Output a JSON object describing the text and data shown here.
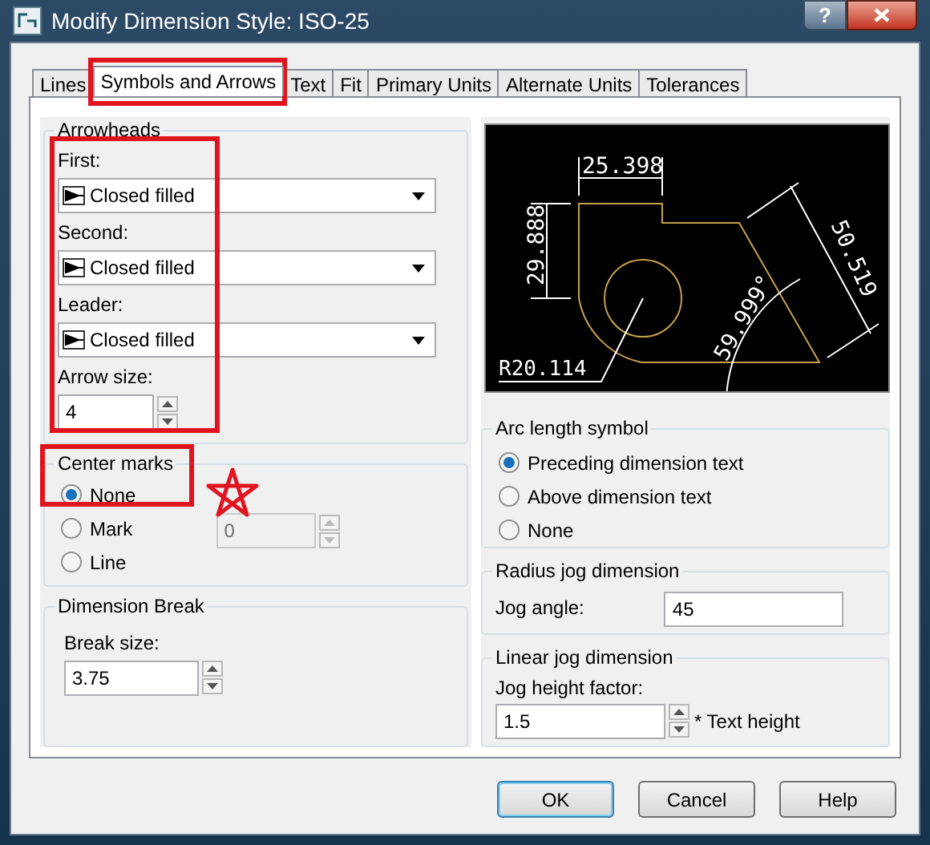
{
  "window": {
    "title": "Modify Dimension Style: ISO-25",
    "help": "?"
  },
  "tabs": [
    {
      "label": "Lines",
      "selected": false
    },
    {
      "label": "Symbols and Arrows",
      "selected": true
    },
    {
      "label": "Text",
      "selected": false
    },
    {
      "label": "Fit",
      "selected": false
    },
    {
      "label": "Primary Units",
      "selected": false
    },
    {
      "label": "Alternate Units",
      "selected": false
    },
    {
      "label": "Tolerances",
      "selected": false
    }
  ],
  "arrowheads": {
    "title": "Arrowheads",
    "fields": [
      {
        "label": "First:",
        "value": "Closed filled"
      },
      {
        "label": "Second:",
        "value": "Closed filled"
      },
      {
        "label": "Leader:",
        "value": "Closed filled"
      }
    ],
    "arrow_size": {
      "label": "Arrow size:",
      "value": "4"
    }
  },
  "center_marks": {
    "title": "Center marks",
    "options": [
      {
        "label": "None",
        "selected": true
      },
      {
        "label": "Mark",
        "selected": false
      },
      {
        "label": "Line",
        "selected": false
      }
    ],
    "size": {
      "value": "0",
      "disabled": true
    }
  },
  "dimension_break": {
    "title": "Dimension Break",
    "label": "Break size:",
    "value": "3.75"
  },
  "preview": {
    "labels": [
      "25.398",
      "29.888",
      "R20.114",
      "59.999°",
      "50.519"
    ]
  },
  "arc_length_symbol": {
    "title": "Arc length symbol",
    "options": [
      {
        "label": "Preceding dimension text",
        "selected": true
      },
      {
        "label": "Above dimension text",
        "selected": false
      },
      {
        "label": "None",
        "selected": false
      }
    ]
  },
  "radius_jog": {
    "title": "Radius jog dimension",
    "label": "Jog angle:",
    "value": "45"
  },
  "linear_jog": {
    "title": "Linear jog dimension",
    "label": "Jog height factor:",
    "value": "1.5",
    "suffix": "* Text height"
  },
  "buttons": [
    {
      "label": "OK",
      "default": true
    },
    {
      "label": "Cancel",
      "default": false
    },
    {
      "label": "Help",
      "default": false
    }
  ],
  "annotations": [
    {
      "kind": "box"
    },
    {
      "kind": "box"
    },
    {
      "kind": "box"
    },
    {
      "kind": "star"
    }
  ]
}
